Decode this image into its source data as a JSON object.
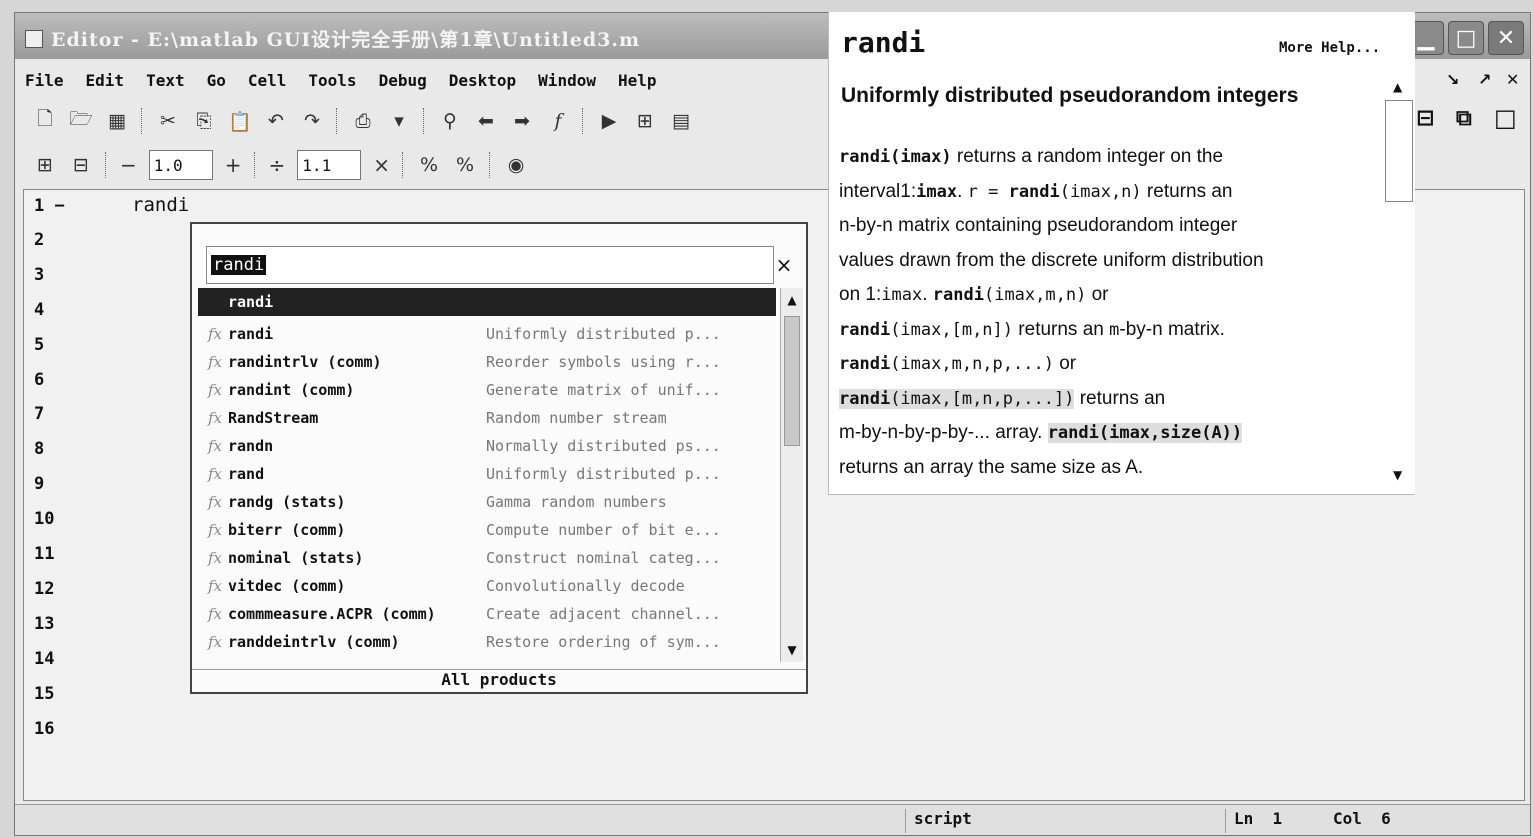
{
  "window": {
    "title": "Editor - E:\\matlab GUI设计完全手册\\第1章\\Untitled3.m"
  },
  "window_controls": {
    "minimize": "▁",
    "maximize": "□",
    "close": "✕"
  },
  "menu": [
    "File",
    "Edit",
    "Text",
    "Go",
    "Cell",
    "Tools",
    "Debug",
    "Desktop",
    "Window",
    "Help"
  ],
  "cell_toolbar": {
    "minus": "−",
    "value1": "1.0",
    "plus": "+",
    "divide": "÷",
    "value2": "1.1",
    "times": "×"
  },
  "editor": {
    "line_numbers": [
      "1 −",
      "2",
      "3",
      "4",
      "5",
      "6",
      "7",
      "8",
      "9",
      "10",
      "11",
      "12",
      "13",
      "14",
      "15",
      "16"
    ],
    "code": "randi"
  },
  "popup": {
    "search_text": "randi",
    "close": "×",
    "items": [
      {
        "name": "randi",
        "desc": ""
      },
      {
        "name": "randi",
        "desc": "Uniformly distributed p..."
      },
      {
        "name": "randintrlv (comm)",
        "desc": "Reorder symbols using r..."
      },
      {
        "name": "randint (comm)",
        "desc": "Generate matrix of unif..."
      },
      {
        "name": "RandStream",
        "desc": "Random number stream"
      },
      {
        "name": "randn",
        "desc": "Normally distributed ps..."
      },
      {
        "name": "rand",
        "desc": "Uniformly distributed p..."
      },
      {
        "name": "randg (stats)",
        "desc": "Gamma random numbers"
      },
      {
        "name": "biterr (comm)",
        "desc": "Compute number of bit e..."
      },
      {
        "name": "nominal (stats)",
        "desc": "Construct nominal categ..."
      },
      {
        "name": "vitdec (comm)",
        "desc": "Convolutionally decode"
      },
      {
        "name": "commmeasure.ACPR (comm)",
        "desc": "Create adjacent channel..."
      },
      {
        "name": "randdeintrlv (comm)",
        "desc": "Restore ordering of sym..."
      }
    ],
    "footer": "All products"
  },
  "help": {
    "title": "randi",
    "more": "More Help...",
    "subtitle": "Uniformly distributed pseudorandom integers",
    "b1": "randi(imax)",
    "t1": " returns a random integer on the",
    "t2a": "interval1:",
    "b2": "imax",
    "t2b": ". ",
    "m2c": "r = ",
    "b2d": "randi",
    "m2e": "(imax,n)",
    "t2f": " returns an",
    "t3": "n-by-n matrix containing pseudorandom integer",
    "t4": "values drawn from the discrete uniform distribution",
    "t5a": "on 1:",
    "m5b": "imax",
    "t5c": ". ",
    "b5d": "randi",
    "m5e": "(imax,m,n)",
    "t5f": " or",
    "b6a": "randi",
    "m6b": "(imax,[m,n])",
    "t6c": " returns an ",
    "m6d": "m",
    "t6e": "-by-n matrix.",
    "b7a": "randi",
    "m7b": "(imax,m,n,p,...)",
    "t7c": " or",
    "b8a": "randi",
    "m8b": "(imax,[m,n,p,...])",
    "t8c": " returns an",
    "t9a": "m-by-n-by-p-by-... array. ",
    "b9b": "randi(imax,size(A))",
    "t10": "returns an array the same size as A."
  },
  "status": {
    "mode": "script",
    "ln_label": "Ln",
    "ln": "1",
    "col_label": "Col",
    "col": "6"
  }
}
